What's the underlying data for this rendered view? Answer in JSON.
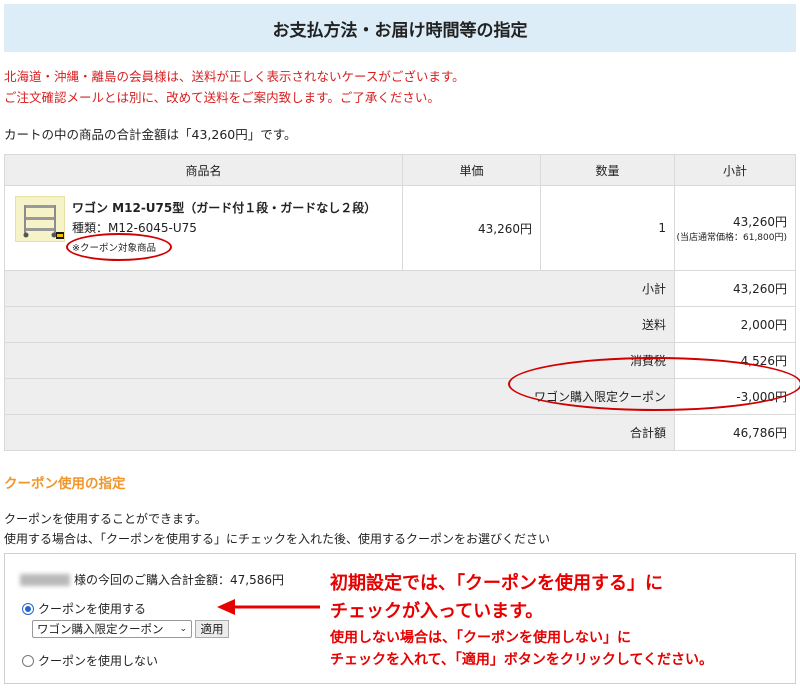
{
  "header": {
    "title": "お支払方法・お届け時間等の指定"
  },
  "notice": {
    "line1": "北海道・沖縄・離島の会員様は、送料が正しく表示されないケースがございます。",
    "line2": "ご注文確認メールとは別に、改めて送料をご案内致します。ご了承ください。"
  },
  "cart_total_text": "カートの中の商品の合計金額は「43,260円」です。",
  "table": {
    "headers": [
      "商品名",
      "単価",
      "数量",
      "小計"
    ],
    "product": {
      "name": "ワゴン M12-U75型（ガード付１段・ガードなし２段）",
      "type": "種類：M12-6045-U75",
      "coupon_tag": "※クーポン対象商品",
      "unit_price": "43,260円",
      "quantity": "1",
      "subtotal": "43,260円",
      "regular_price": "(当店通常価格：61,800円)"
    },
    "summary": [
      {
        "label": "小計",
        "value": "43,260円"
      },
      {
        "label": "送料",
        "value": "2,000円"
      },
      {
        "label": "消費税",
        "value": "4,526円"
      },
      {
        "label": "ワゴン購入限定クーポン",
        "value": "-3,000円"
      },
      {
        "label": "合計額",
        "value": "46,786円"
      }
    ]
  },
  "coupon_section": {
    "title": "クーポン使用の指定",
    "text1": "クーポンを使用することができます。",
    "text2": "使用する場合は、「クーポンを使用する」にチェックを入れた後、使用するクーポンをお選びください",
    "purchase_total": "様の今回のご購入合計金額：47,586円",
    "use_label": "クーポンを使用する",
    "select_value": "ワゴン購入限定クーポン",
    "apply_label": "適用",
    "nouse_label": "クーポンを使用しない"
  },
  "annotation": {
    "line1": "初期設定では、「クーポンを使用する」に",
    "line2": "チェックが入っています。",
    "line3": "使用しない場合は、「クーポンを使用しない」に",
    "line4": "チェックを入れて、「適用」ボタンをクリックしてください。"
  },
  "colors": {
    "notice": "#d62020",
    "annotation": "#e60000",
    "section_title": "#f0962c",
    "header_bg": "#dcedf8"
  }
}
